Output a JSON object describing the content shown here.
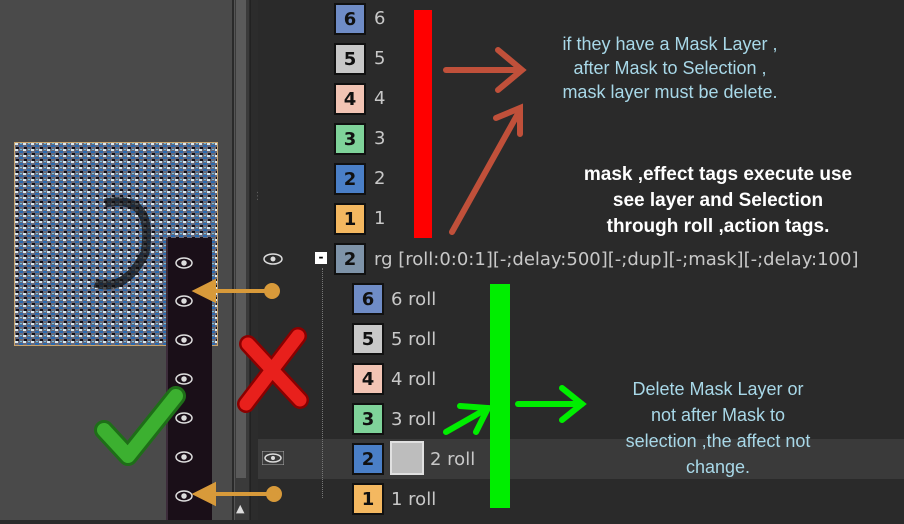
{
  "layers_top": [
    {
      "num": "6",
      "name": "6",
      "color": "#6f8cc6"
    },
    {
      "num": "5",
      "name": "5",
      "color": "#c8c8c8"
    },
    {
      "num": "4",
      "name": "4",
      "color": "#f2c4b4"
    },
    {
      "num": "3",
      "name": "3",
      "color": "#7fd39a"
    },
    {
      "num": "2",
      "name": "2",
      "color": "#4a7fc7"
    },
    {
      "num": "1",
      "name": "1",
      "color": "#f4b860"
    }
  ],
  "group": {
    "num": "2",
    "name": "rg [roll:0:0:1][-;delay:500][-;dup][-;mask][-;delay:100]",
    "collapse": "-"
  },
  "layers_group": [
    {
      "num": "6",
      "name": "6 roll",
      "color": "#6f8cc6"
    },
    {
      "num": "5",
      "name": "5 roll",
      "color": "#c8c8c8"
    },
    {
      "num": "4",
      "name": "4 roll",
      "color": "#f2c4b4"
    },
    {
      "num": "3",
      "name": "3 roll",
      "color": "#7fd39a"
    },
    {
      "num": "2",
      "name": "2 roll",
      "color": "#4a7fc7"
    },
    {
      "num": "1",
      "name": "1 roll",
      "color": "#f4b860"
    }
  ],
  "annotations": {
    "note1": [
      "if they have a Mask Layer ,",
      "after Mask to Selection ,",
      "mask layer must be delete."
    ],
    "note2": [
      "mask ,effect tags execute use",
      "see layer and Selection",
      "through roll ,action tags."
    ],
    "note3": [
      "Delete Mask Layer or",
      "not after Mask to",
      "selection ,the affect not",
      "change."
    ]
  },
  "colors": {
    "red_bar": "#ff0000",
    "green_bar": "#00ee00",
    "arrow_red": "#c0503a",
    "arrow_orange": "#d89a3a",
    "cross": "#e8201c",
    "check": "#3cb030"
  }
}
